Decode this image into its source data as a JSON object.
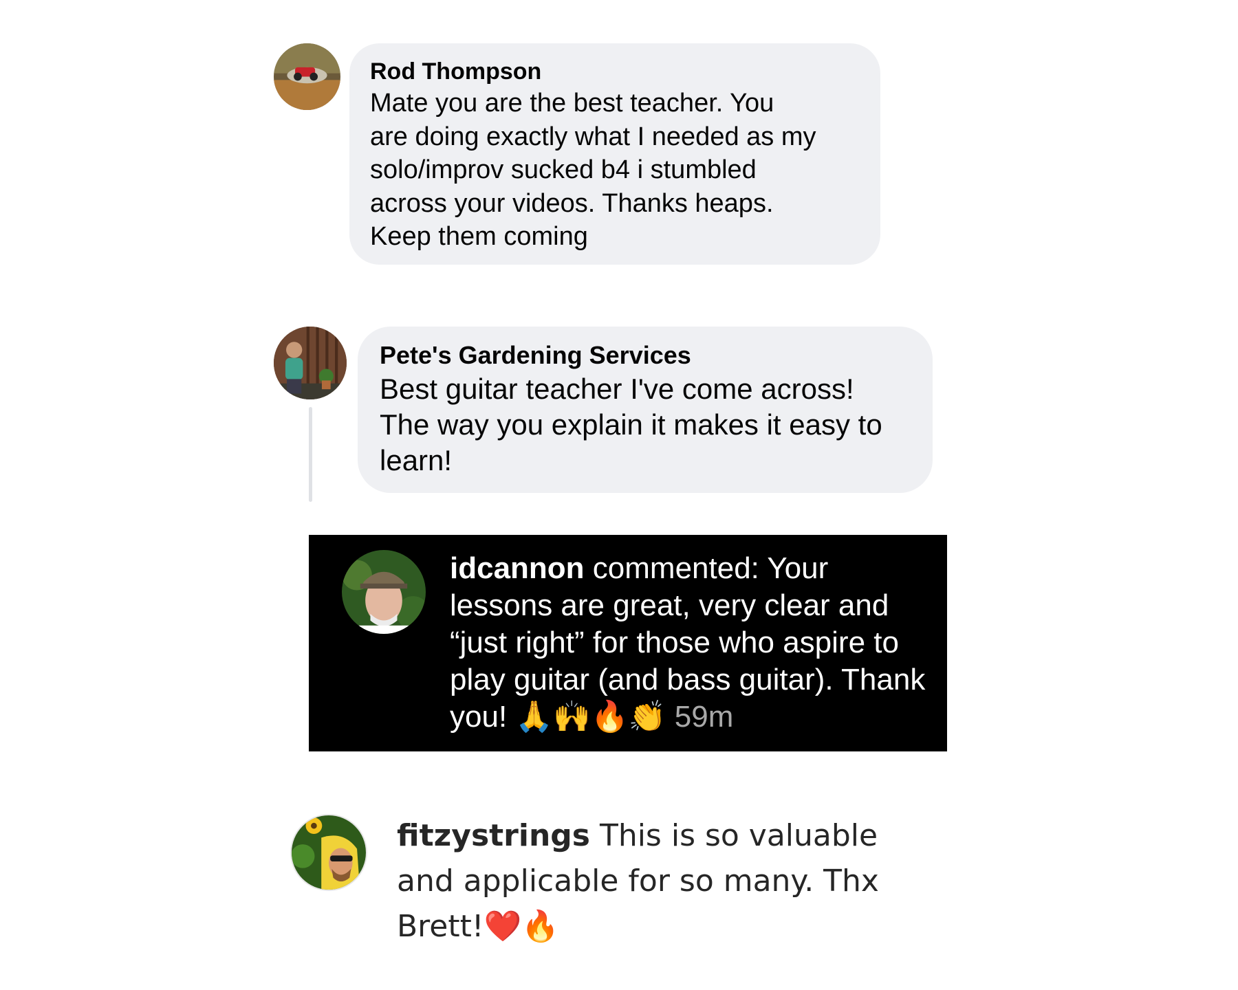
{
  "comments": [
    {
      "author": "Rod Thompson",
      "text": "Mate you are the best teacher.  You\nare doing exactly  what I needed as my\nsolo/improv sucked b4 i stumbled\nacross your videos. Thanks heaps.\nKeep them coming"
    },
    {
      "author": "Pete's Gardening Services",
      "text": "Best guitar teacher I've come across!\nThe way you explain it makes it easy to\nlearn!"
    },
    {
      "author": "idcannon",
      "text": " commented: Your lessons are great, very clear and “just right” for those who aspire to play guitar (and bass guitar). Thank you! 🙏🙌🔥👏 ",
      "time": "59m"
    },
    {
      "author": "fitzystrings",
      "text": " This is so valuable and applicable for so many. Thx Brett!❤️🔥"
    }
  ]
}
